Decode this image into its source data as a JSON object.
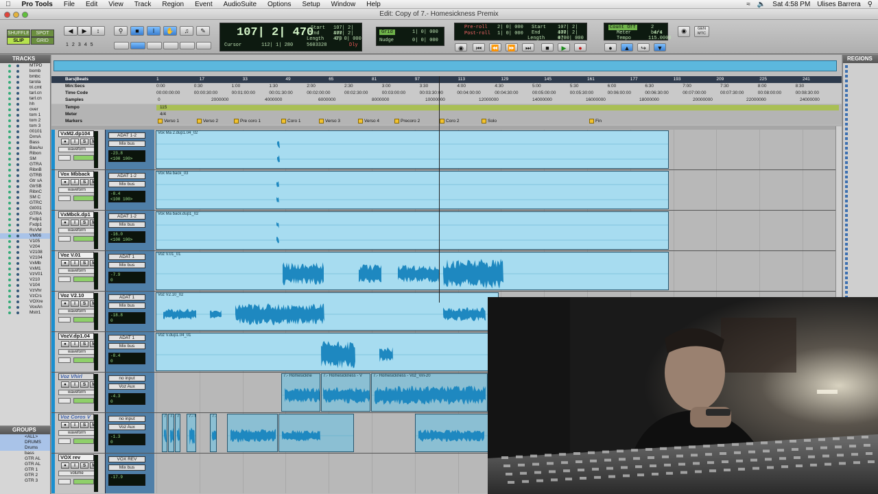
{
  "menubar": {
    "app_name": "Pro Tools",
    "items": [
      "File",
      "Edit",
      "View",
      "Track",
      "Region",
      "Event",
      "AudioSuite",
      "Options",
      "Setup",
      "Window",
      "Help"
    ],
    "clock": "Sat 4:58 PM",
    "user": "Ulises Barrera"
  },
  "window": {
    "title": "Edit: Copy of 7.- Homesickness Premix"
  },
  "toolbar": {
    "modes": [
      "SHUFFLE",
      "SPOT",
      "SLIP",
      "GRID"
    ],
    "zoom_presets": [
      "1",
      "2",
      "3",
      "4",
      "5"
    ],
    "main_counter": "107| 2| 470",
    "cursor_label": "Cursor",
    "cursor_value": "112| 1| 280",
    "sample_value": "5603328",
    "dly_label": "Dly",
    "start_label": "Start",
    "start_value": "107| 2| 470",
    "end_label": "End",
    "end_value": "107| 2| 470",
    "length_label": "Length",
    "length_value": "0| 0| 000",
    "grid_label": "Grid",
    "grid_value": "1| 0| 000",
    "nudge_label": "Nudge",
    "nudge_value": "0| 0| 000",
    "preroll_label": "Pre-roll",
    "preroll_value": "2| 0| 000",
    "postroll_label": "Post-roll",
    "postroll_value": "1| 0| 000",
    "t_start_label": "Start",
    "t_start_value": "107| 2| 470",
    "t_end_label": "End",
    "t_end_value": "107| 2| 470",
    "t_length_label": "Length",
    "t_length_value": "0| 0| 000",
    "countoff_label": "Count Off",
    "countoff_value": "2 bars",
    "meter_label": "Meter",
    "meter_value": "4/4",
    "tempo_label": "Tempo",
    "tempo_value": "115.0000",
    "gen_mtc": "GEN MTC"
  },
  "tracks_panel": {
    "title": "TRACKS",
    "names": [
      "MTPD",
      "bomb",
      "bmbc",
      "tarola",
      "tri.cmt",
      "tarl.cn",
      "tarl.cn",
      "hh",
      "over",
      "tom 1",
      "tom 2",
      "tom 3",
      "00101",
      "DrmA",
      "Bass",
      "BasAu",
      "Ribon",
      "SM",
      "GTRA",
      "RibnB",
      "GTRB",
      "Gtr sA",
      "GtrSB",
      "RibnC",
      "SM C",
      "GTRC",
      "Gt001",
      "GTRA",
      "Fxdp1",
      "Fxdp1",
      "RcVM",
      "VM06",
      "V105",
      "V204",
      "V2108",
      "V2104",
      "VxMb",
      "VxM1",
      "VzV01",
      "V210",
      "V104",
      "VzVhr",
      "VzCrs",
      "VOXre",
      "VoxAn",
      "Mstr1"
    ]
  },
  "groups_panel": {
    "title": "GROUPS",
    "names": [
      "<ALL>",
      "DRUMS",
      "Drums",
      "bass",
      "GTR AL",
      "GTR AL",
      "GTR 1",
      "GTR 2",
      "GTR 3"
    ]
  },
  "regions_panel": {
    "title": "REGIONS"
  },
  "rulers": {
    "labels": [
      "Bars|Beats",
      "Min:Secs",
      "Time Code",
      "Samples",
      "Tempo",
      "Meter",
      "Markers"
    ],
    "bars": [
      "1",
      "17",
      "33",
      "49",
      "65",
      "81",
      "97",
      "113",
      "129",
      "145",
      "161",
      "177",
      "193",
      "209",
      "225",
      "241"
    ],
    "minsecs": [
      "0:00",
      "0:30",
      "1:00",
      "1:30",
      "2:00",
      "2:30",
      "3:00",
      "3:30",
      "4:00",
      "4:30",
      "5:00",
      "5:30",
      "6:00",
      "6:30",
      "7:00",
      "7:30",
      "8:00",
      "8:30"
    ],
    "timecode": [
      "00:00:00:00",
      "00:00:30:00",
      "00:01:00:00",
      "00:01:30:00",
      "00:02:00:00",
      "00:02:30:00",
      "00:03:00:00",
      "00:03:30:00",
      "00:04:00:00",
      "00:04:30:00",
      "00:05:00:00",
      "00:05:30:00",
      "00:06:00:00",
      "00:06:30:00",
      "00:07:00:00",
      "00:07:30:00",
      "00:08:00:00",
      "00:08:30:00"
    ],
    "samples": [
      "0",
      "2000000",
      "4000000",
      "6000000",
      "8000000",
      "10000000",
      "12000000",
      "14000000",
      "16000000",
      "18000000",
      "20000000",
      "22000000",
      "24000000"
    ],
    "tempo_value": "115",
    "meter_value": "4/4",
    "markers": [
      "Verso 1",
      "Verso 2",
      "Pre coro 1",
      "Coro 1",
      "Verso 3",
      "Verso 4",
      "Precoro 2",
      "Coro 2",
      "Solo",
      "Fin"
    ]
  },
  "tracks": [
    {
      "name": "VxM2.dp104",
      "inactive": false,
      "input": "ADAT 1-2",
      "output": "Mix bus",
      "view": "waveform",
      "vol": "-23.8",
      "pan": "<100  100>",
      "pan_label": "",
      "regions": [
        {
          "name": "Vox Ma 2.dup1.04_02"
        }
      ]
    },
    {
      "name": "Vox Mbback",
      "inactive": false,
      "input": "ADAT 1-2",
      "output": "Mix bus",
      "view": "waveform",
      "vol": "-8.4",
      "pan": "<100  100>",
      "pan_label": "",
      "regions": [
        {
          "name": "Vox Ma back_03"
        }
      ]
    },
    {
      "name": "VxMbck.dp1",
      "inactive": false,
      "input": "ADAT 1-2",
      "output": "Mix bus",
      "view": "waveform",
      "vol": "-16.0",
      "pan": "<100  100>",
      "pan_label": "",
      "regions": [
        {
          "name": "Vox Ma back.dup1_02"
        }
      ]
    },
    {
      "name": "Voz V.01",
      "inactive": false,
      "input": "ADAT 1",
      "output": "Mix bus",
      "view": "waveform",
      "vol": "-7.9",
      "pan": "0",
      "pan_label": "pan",
      "regions": [
        {
          "name": "Voz V.01_01"
        }
      ]
    },
    {
      "name": "Voz V2.10",
      "inactive": false,
      "input": "ADAT 1",
      "output": "Mix bus",
      "view": "waveform",
      "vol": "-18.8",
      "pan": "0",
      "pan_label": "pan",
      "regions": [
        {
          "name": "Voz V2.10_02"
        }
      ]
    },
    {
      "name": "VozV.dp1.04",
      "inactive": false,
      "input": "ADAT 1",
      "output": "Mix bus",
      "view": "waveform",
      "vol": "-8.4",
      "pan": "0",
      "pan_label": "pan",
      "regions": [
        {
          "name": "Voz V.dup1.04_01"
        }
      ]
    },
    {
      "name": "Voz Vhirl",
      "inactive": true,
      "input": "no input",
      "output": "Voz Aux",
      "view": "waveform",
      "vol": "-4.3",
      "pan": "0",
      "pan_label": "pan",
      "regions": [
        {
          "name": "7.- Homesickne"
        },
        {
          "name": "7.- Homesickness - V"
        },
        {
          "name": "7.- Homesickness - Voz_Viri-20"
        }
      ]
    },
    {
      "name": "Voz Coros V",
      "inactive": true,
      "input": "no input",
      "output": "Voz Aux",
      "view": "waveform",
      "vol": "-1.3",
      "pan": "0",
      "pan_label": "pan",
      "regions": [
        {
          "name": "7"
        },
        {
          "name": "7.-"
        },
        {
          "name": "7.- Homesickness - V"
        },
        {
          "name": "7.- Homesickness - Voz_Coros V"
        },
        {
          "name": "7.- Homesickness - Voz_Coros"
        }
      ]
    },
    {
      "name": "VOX rev",
      "inactive": false,
      "input": "VOX REV",
      "output": "Mix bus",
      "view": "volume",
      "vol": "-17.9",
      "pan": "",
      "pan_label": "",
      "regions": []
    }
  ],
  "colors": {
    "accent": "#1a8fd0",
    "region": "#a7dcf0",
    "waveform": "#1e88c0",
    "universe": "#5cb8dd",
    "marker": "#f2c230"
  }
}
